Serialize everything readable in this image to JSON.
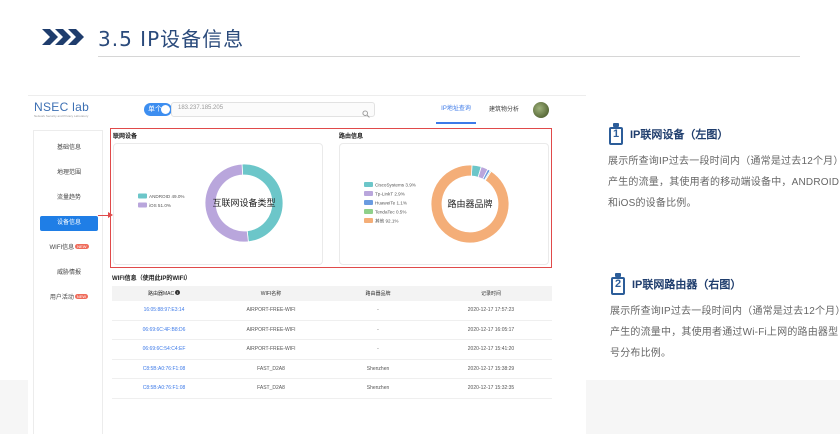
{
  "slide": {
    "title": "3.5 IP设备信息"
  },
  "app": {
    "logo": "NSEC lab",
    "logo_sub": "Network Security and Privacy Laboratory",
    "toggle_label": "单个",
    "search_value": "183.237.185.205",
    "nav": {
      "ip": "IP地址查询",
      "building": "建筑物分析"
    },
    "sidebar": [
      {
        "label": "基础信息",
        "badge": ""
      },
      {
        "label": "地理范围",
        "badge": ""
      },
      {
        "label": "流量趋势",
        "badge": ""
      },
      {
        "label": "设备信息",
        "badge": ""
      },
      {
        "label": "WIFI信息",
        "badge": "NEW"
      },
      {
        "label": "威胁情报",
        "badge": ""
      },
      {
        "label": "用户活动",
        "badge": "NEW"
      }
    ],
    "panels": {
      "left_title": "联网设备",
      "right_title": "路由信息",
      "left_center": "互联网设备类型",
      "right_center": "路由器品牌"
    },
    "wifi": {
      "title": "WIFI信息（使用此IP的WIFI）",
      "columns": [
        "路由器MAC",
        "WIFI名称",
        "路由器品牌",
        "记录时间"
      ],
      "rows": [
        [
          "16:05:88:97:E3:14",
          "AIRPORT-FREE-WIFI",
          "-",
          "2020-12-17 17:57:23"
        ],
        [
          "06:69:6C:4F:B8:D6",
          "AIRPORT-FREE-WIFI",
          "-",
          "2020-12-17 16:05:17"
        ],
        [
          "06:69:6C:54:C4:EF",
          "AIRPORT-FREE-WIFI",
          "-",
          "2020-12-17 15:41:20"
        ],
        [
          "C8:5B:A0:76:F1:08",
          "FAST_D2A8",
          "Shenzhen",
          "2020-12-17 15:38:29"
        ],
        [
          "C8:5B:A0:76:F1:08",
          "FAST_D2A8",
          "Shenzhen",
          "2020-12-17 15:32:35"
        ]
      ]
    }
  },
  "chart_data": [
    {
      "type": "pie",
      "title": "互联网设备类型",
      "categories": [
        "ANDROID 49.0%",
        "iOS 51.0%"
      ],
      "values": [
        49.0,
        51.0
      ],
      "colors": [
        "#6cc6c9",
        "#b9a6dc"
      ],
      "legend": "left"
    },
    {
      "type": "pie",
      "title": "路由器品牌",
      "categories": [
        "CiscoSystems 3.9%",
        "Tp-LinkT 2.9%",
        "HuaweiTe 1.1%",
        "TendaTec 0.5%",
        "其他 92.1%"
      ],
      "values": [
        3.9,
        2.9,
        1.1,
        0.5,
        92.1
      ],
      "colors": [
        "#6cc6c9",
        "#b9a6dc",
        "#6a9be0",
        "#8fd08a",
        "#f4ae78"
      ],
      "legend": "left"
    }
  ],
  "descriptions": [
    {
      "num": "1",
      "title": "IP联网设备（左图）",
      "text": "展示所查询IP过去一段时间内（通常是过去12个月）产生的流量，其使用者的移动端设备中，ANDROID和iOS的设备比例。"
    },
    {
      "num": "2",
      "title": "IP联网路由器（右图）",
      "text": "展示所查询IP过去一段时间内（通常是过去12个月）产生的流量中，其使用者通过Wi-Fi上网的路由器型号分布比例。"
    }
  ]
}
